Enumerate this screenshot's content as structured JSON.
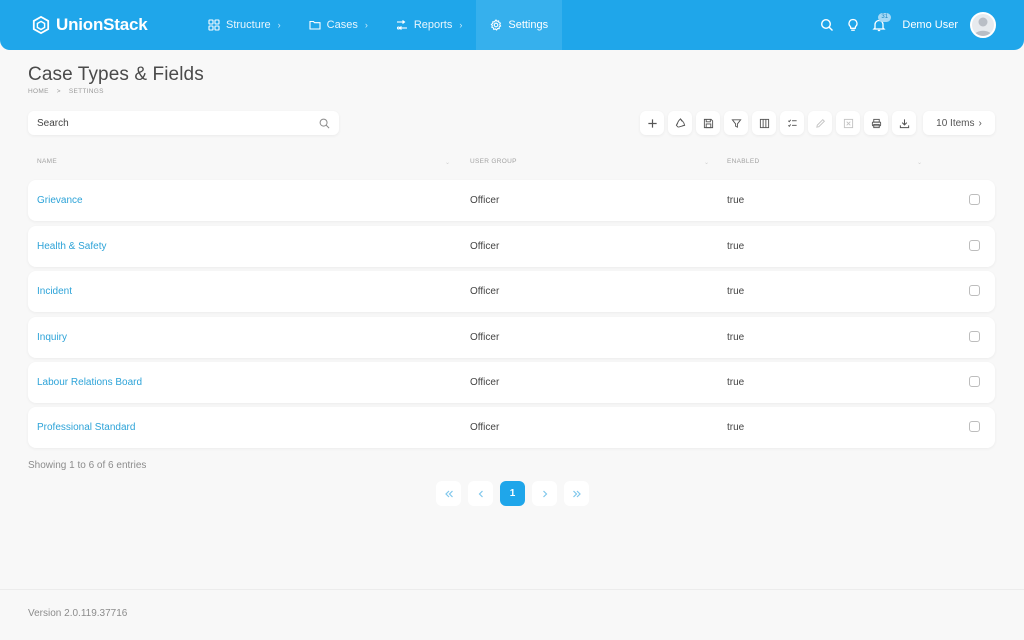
{
  "app": {
    "name": "UnionStack",
    "accent": "#1fa6ea"
  },
  "nav": [
    {
      "label": "Structure",
      "icon": "grid-icon",
      "has_submenu": true
    },
    {
      "label": "Cases",
      "icon": "folder-icon",
      "has_submenu": true
    },
    {
      "label": "Reports",
      "icon": "filter-flow-icon",
      "has_submenu": true
    },
    {
      "label": "Settings",
      "icon": "gear-icon",
      "has_submenu": false,
      "active": true
    }
  ],
  "header_tools": {
    "notifications_count": "31",
    "user_name": "Demo User"
  },
  "page": {
    "title": "Case Types & Fields",
    "breadcrumb": [
      "HOME",
      "SETTINGS"
    ],
    "breadcrumb_separator": ">"
  },
  "search": {
    "placeholder": "Search",
    "value": ""
  },
  "toolbar": {
    "items_label": "10 Items",
    "items_chevron": "›"
  },
  "table": {
    "columns": [
      "NAME",
      "USER GROUP",
      "ENABLED"
    ],
    "rows": [
      {
        "name": "Grievance",
        "group": "Officer",
        "enabled": "true"
      },
      {
        "name": "Health & Safety",
        "group": "Officer",
        "enabled": "true"
      },
      {
        "name": "Incident",
        "group": "Officer",
        "enabled": "true"
      },
      {
        "name": "Inquiry",
        "group": "Officer",
        "enabled": "true"
      },
      {
        "name": "Labour Relations Board",
        "group": "Officer",
        "enabled": "true"
      },
      {
        "name": "Professional Standard",
        "group": "Officer",
        "enabled": "true"
      }
    ]
  },
  "pagination": {
    "summary": "Showing 1 to 6 of 6 entries",
    "current_page": "1"
  },
  "footer": {
    "version": "Version 2.0.119.37716"
  }
}
